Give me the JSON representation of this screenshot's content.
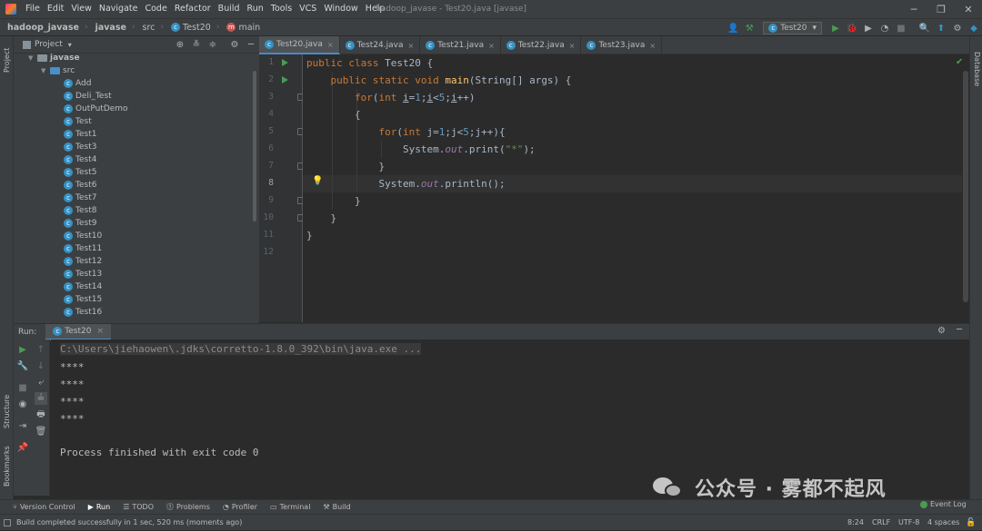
{
  "menubar": {
    "items": [
      "File",
      "Edit",
      "View",
      "Navigate",
      "Code",
      "Refactor",
      "Build",
      "Run",
      "Tools",
      "VCS",
      "Window",
      "Help"
    ],
    "window_title": "hadoop_javase - Test20.java [javase]"
  },
  "navbar": {
    "crumbs": [
      "hadoop_javase",
      "javase",
      "src",
      "Test20",
      "main"
    ],
    "run_config": "Test20"
  },
  "project": {
    "title": "Project",
    "root": "javase",
    "folder": "src",
    "files": [
      "Add",
      "Deli_Test",
      "OutPutDemo",
      "Test",
      "Test1",
      "Test3",
      "Test4",
      "Test5",
      "Test6",
      "Test7",
      "Test8",
      "Test9",
      "Test10",
      "Test11",
      "Test12",
      "Test13",
      "Test14",
      "Test15",
      "Test16"
    ]
  },
  "editor": {
    "tabs": [
      "Test20.java",
      "Test24.java",
      "Test21.java",
      "Test22.java",
      "Test23.java"
    ],
    "line_numbers": [
      "1",
      "2",
      "3",
      "4",
      "5",
      "6",
      "7",
      "8",
      "9",
      "10",
      "11",
      "12"
    ],
    "current_line": 8,
    "lines": [
      [
        [
          "kw",
          "public class "
        ],
        [
          "",
          "Test20 "
        ],
        [
          "",
          "{"
        ]
      ],
      [
        [
          "",
          "    "
        ],
        [
          "kw",
          "public static void "
        ],
        [
          "fn",
          "main"
        ],
        [
          "",
          "(String[] args) {"
        ]
      ],
      [
        [
          "",
          "        "
        ],
        [
          "kw",
          "for"
        ],
        [
          "",
          "("
        ],
        [
          "kw",
          "int "
        ],
        [
          "ul",
          "i"
        ],
        [
          "",
          "="
        ],
        [
          "num",
          "1"
        ],
        [
          "",
          ";"
        ],
        [
          "ul",
          "i"
        ],
        [
          "",
          "<"
        ],
        [
          "num",
          "5"
        ],
        [
          "",
          ";"
        ],
        [
          "ul",
          "i"
        ],
        [
          "",
          "++)"
        ]
      ],
      [
        [
          "",
          "        {"
        ]
      ],
      [
        [
          "",
          "            "
        ],
        [
          "kw",
          "for"
        ],
        [
          "",
          "("
        ],
        [
          "kw",
          "int "
        ],
        [
          "",
          "j="
        ],
        [
          "num",
          "1"
        ],
        [
          "",
          ";j<"
        ],
        [
          "num",
          "5"
        ],
        [
          "",
          ";j++){"
        ]
      ],
      [
        [
          "",
          "                System."
        ],
        [
          "it",
          "out"
        ],
        [
          "",
          ".print("
        ],
        [
          "str",
          "\"*\""
        ],
        [
          "",
          ");"
        ]
      ],
      [
        [
          "",
          "            }"
        ]
      ],
      [
        [
          "",
          "            System."
        ],
        [
          "it",
          "out"
        ],
        [
          "",
          ".println();"
        ]
      ],
      [
        [
          "",
          "        }"
        ]
      ],
      [
        [
          "",
          "    }"
        ]
      ],
      [
        [
          "",
          "}"
        ]
      ],
      [
        [
          "",
          ""
        ]
      ]
    ]
  },
  "run_panel": {
    "label": "Run:",
    "tab": "Test20",
    "command": "C:\\Users\\jiehaowen\\.jdks\\corretto-1.8.0_392\\bin\\java.exe ...",
    "output": [
      "****",
      "****",
      "****",
      "****"
    ],
    "exit_message": "Process finished with exit code 0"
  },
  "left_stripe": {
    "project": "Project",
    "structure": "Structure",
    "bookmarks": "Bookmarks"
  },
  "right_stripe": {
    "database": "Database"
  },
  "bottom_tabs": [
    "Version Control",
    "Run",
    "TODO",
    "Problems",
    "Profiler",
    "Terminal",
    "Build"
  ],
  "event_log": "Event Log",
  "status": {
    "message": "Build completed successfully in 1 sec, 520 ms (moments ago)",
    "position": "8:24",
    "line_sep": "CRLF",
    "encoding": "UTF-8",
    "indent": "4 spaces"
  },
  "watermark": {
    "text": "公众号 · 雾都不起风"
  },
  "colors": {
    "keyword": "#cc7832",
    "function": "#ffc66d",
    "string": "#6a8759",
    "field": "#9876aa",
    "number": "#6897bb",
    "accent": "#4a88c7"
  }
}
